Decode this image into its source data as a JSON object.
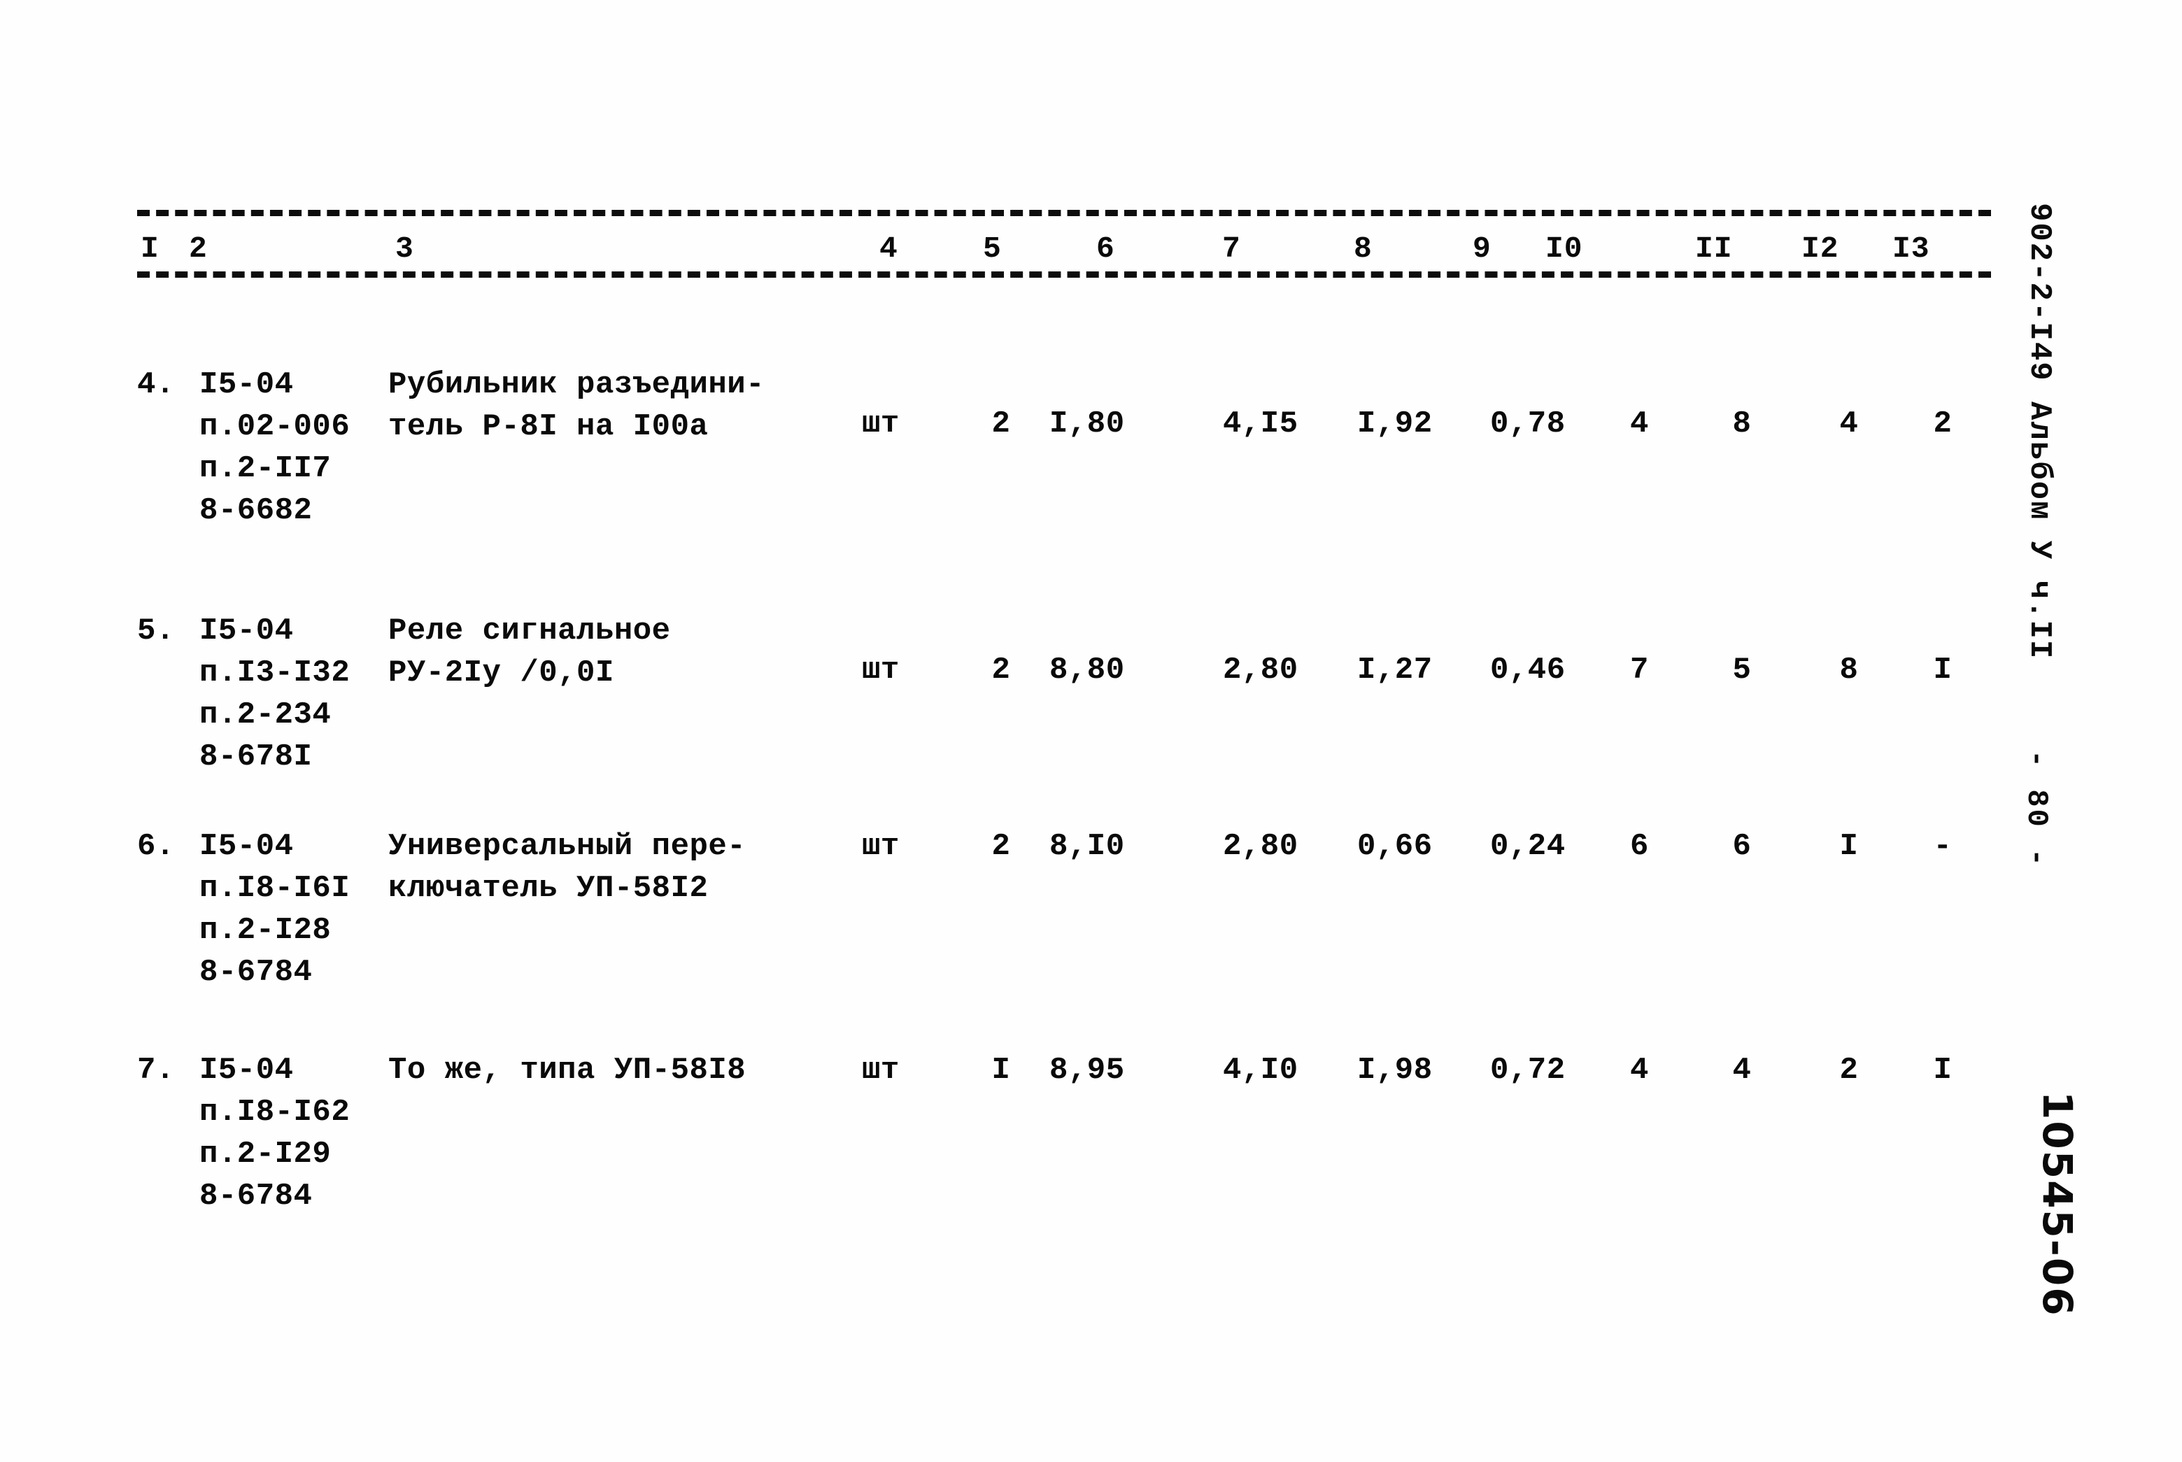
{
  "document": {
    "album_reference": "902-2-I49 Альбом У ч.II",
    "page_number": "- 80 -",
    "archive_stamp": "10545-06"
  },
  "table": {
    "column_headers": [
      "I",
      "2",
      "3",
      "4",
      "5",
      "6",
      "7",
      "8",
      "9",
      "I0",
      "II",
      "I2",
      "I3"
    ],
    "rows": [
      {
        "index": "4.",
        "code_lines": "I5-04\nп.02-006\nп.2-II7\n8-6682",
        "name_lines": "Рубильник разъедини-\nтель Р-8I на I00а",
        "unit": "шт",
        "quantity": "2",
        "col6": "I,80",
        "col7": "4,I5",
        "col8": "I,92",
        "col9": "0,78",
        "col10": "4",
        "col11": "8",
        "col12": "4",
        "col13": "2"
      },
      {
        "index": "5.",
        "code_lines": "I5-04\nп.I3-I32\nп.2-234\n8-678I",
        "name_lines": "Реле сигнальное\nРУ-2Iу /0,0I",
        "unit": "шт",
        "quantity": "2",
        "col6": "8,80",
        "col7": "2,80",
        "col8": "I,27",
        "col9": "0,46",
        "col10": "7",
        "col11": "5",
        "col12": "8",
        "col13": "I"
      },
      {
        "index": "6.",
        "code_lines": "I5-04\nп.I8-I6I\nп.2-I28\n8-6784",
        "name_lines": "Универсальный пере-\nключатель УП-58I2",
        "unit": "шт",
        "quantity": "2",
        "col6": "8,I0",
        "col7": "2,80",
        "col8": "0,66",
        "col9": "0,24",
        "col10": "6",
        "col11": "6",
        "col12": "I",
        "col13": "-"
      },
      {
        "index": "7.",
        "code_lines": "I5-04\nп.I8-I62\nп.2-I29\n8-6784",
        "name_lines": "То же, типа УП-58I8",
        "unit": "шт",
        "quantity": "I",
        "col6": "8,95",
        "col7": "4,I0",
        "col8": "I,98",
        "col9": "0,72",
        "col10": "4",
        "col11": "4",
        "col12": "2",
        "col13": "I"
      }
    ]
  }
}
